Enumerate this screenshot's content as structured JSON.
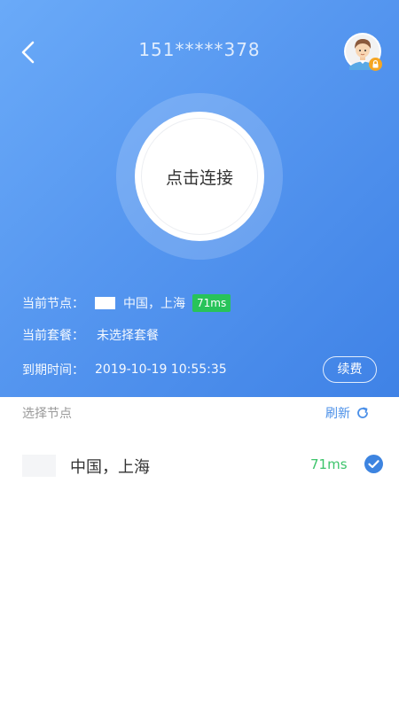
{
  "header": {
    "phone": "151*****378"
  },
  "connect": {
    "label": "点击连接"
  },
  "info": {
    "current_node_label": "当前节点：",
    "current_node_value": "中国，上海",
    "current_node_latency": "71ms",
    "current_plan_label": "当前套餐：",
    "current_plan_value": "未选择套餐",
    "expire_label": "到期时间：",
    "expire_value": "2019-10-19 10:55:35",
    "renew_label": "续费"
  },
  "nodes": {
    "section_title": "选择节点",
    "refresh_label": "刷新",
    "items": [
      {
        "name": "中国，上海",
        "latency": "71ms",
        "selected": true
      }
    ]
  },
  "colors": {
    "gradient_start": "#6aaaf8",
    "gradient_end": "#3f82e6",
    "latency_green": "#28c35a",
    "accent_blue": "#4a8fe8"
  },
  "icons": {
    "back": "chevron-left-icon",
    "avatar": "user-avatar-icon",
    "lock": "lock-icon",
    "refresh": "refresh-icon",
    "check": "check-circle-icon"
  }
}
